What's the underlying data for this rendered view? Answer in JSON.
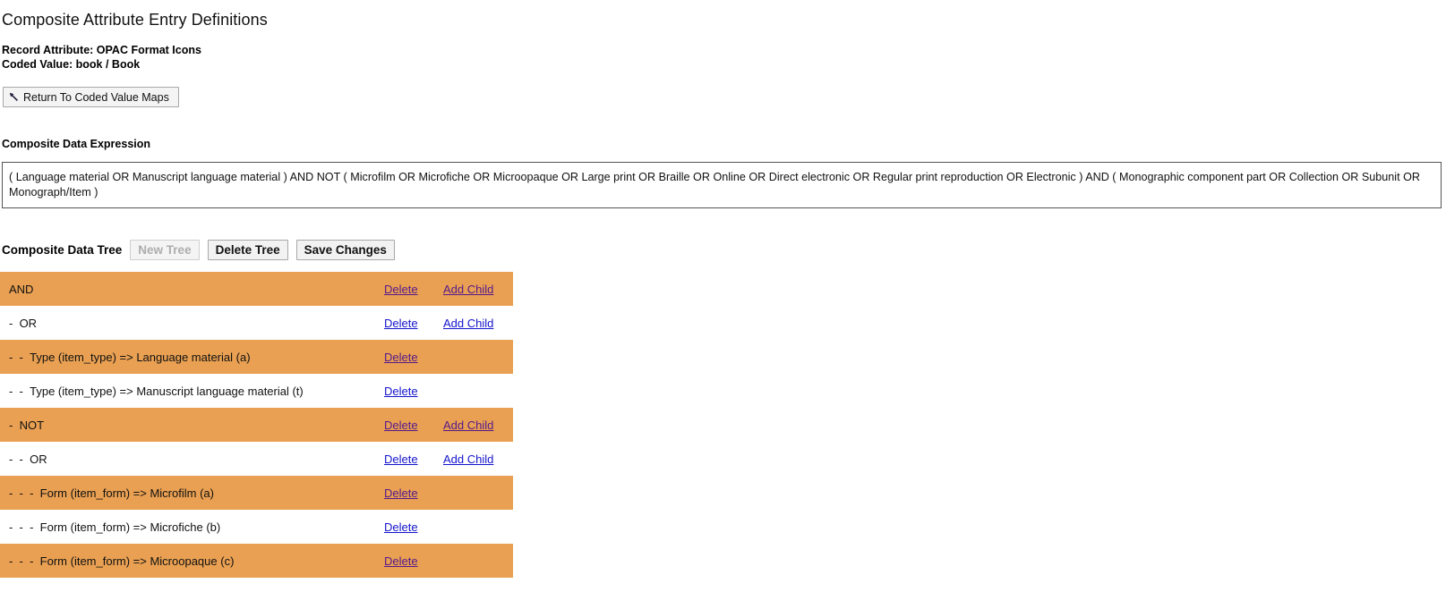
{
  "page": {
    "title": "Composite Attribute Entry Definitions"
  },
  "record": {
    "attribute_line": "Record Attribute: OPAC Format Icons",
    "coded_value_line": "Coded Value: book / Book"
  },
  "actions": {
    "return_label": "Return To Coded Value Maps",
    "return_icon": "back-arrow-icon"
  },
  "expression": {
    "label": "Composite Data Expression",
    "value": "( Language material OR Manuscript language material ) AND NOT ( Microfilm OR Microfiche OR Microopaque OR Large print OR Braille OR Online OR Direct electronic OR Regular print reproduction OR Electronic ) AND ( Monographic component part OR Collection OR Subunit OR Monograph/Item )"
  },
  "tree_toolbar": {
    "label": "Composite Data Tree",
    "new_tree_label": "New Tree",
    "new_tree_disabled": true,
    "delete_tree_label": "Delete Tree",
    "save_changes_label": "Save Changes"
  },
  "tree": {
    "delete_label": "Delete",
    "add_child_label": "Add Child",
    "rows": [
      {
        "dashes": "",
        "label": "AND",
        "delete": "Delete",
        "add_child": "Add Child",
        "shade": "odd"
      },
      {
        "dashes": "-",
        "label": "OR",
        "delete": "Delete",
        "add_child": "Add Child",
        "shade": "even"
      },
      {
        "dashes": "-  -",
        "label": "Type (item_type) => Language material (a)",
        "delete": "Delete",
        "add_child": "",
        "shade": "odd"
      },
      {
        "dashes": "-  -",
        "label": "Type (item_type) => Manuscript language material (t)",
        "delete": "Delete",
        "add_child": "",
        "shade": "even"
      },
      {
        "dashes": "-",
        "label": "NOT",
        "delete": "Delete",
        "add_child": "Add Child",
        "shade": "odd"
      },
      {
        "dashes": "-  -",
        "label": "OR",
        "delete": "Delete",
        "add_child": "Add Child",
        "shade": "even"
      },
      {
        "dashes": "-  -  -",
        "label": "Form (item_form) => Microfilm (a)",
        "delete": "Delete",
        "add_child": "",
        "shade": "odd"
      },
      {
        "dashes": "-  -  -",
        "label": "Form (item_form) => Microfiche (b)",
        "delete": "Delete",
        "add_child": "",
        "shade": "even"
      },
      {
        "dashes": "-  -  -",
        "label": "Form (item_form) => Microopaque (c)",
        "delete": "Delete",
        "add_child": "",
        "shade": "odd"
      }
    ]
  },
  "colors": {
    "row_highlight": "#e9a052",
    "row_plain": "#ffffff",
    "link_visited": "#551a8b",
    "link_unvisited": "#1414cc"
  }
}
